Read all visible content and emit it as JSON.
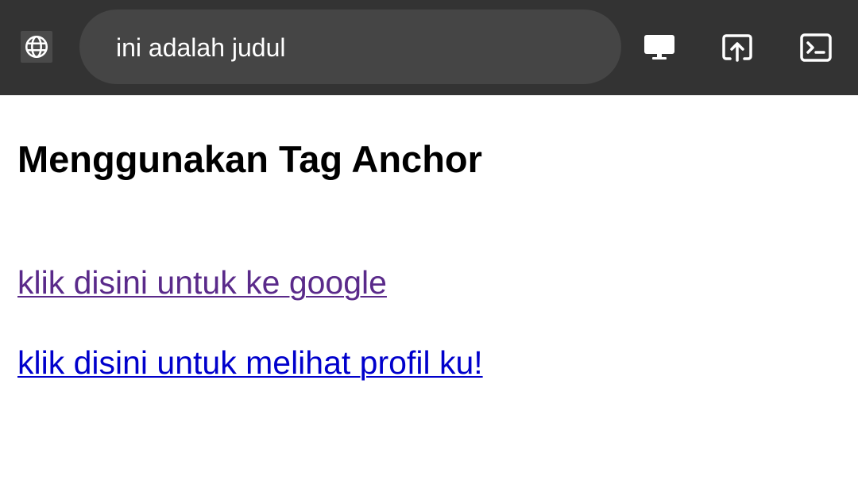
{
  "browser": {
    "address_text": "ini adalah judul",
    "site_icon": "globe-icon",
    "actions": [
      {
        "icon": "desktop-icon"
      },
      {
        "icon": "share-icon"
      },
      {
        "icon": "terminal-icon"
      }
    ],
    "toolbar_color": "#333333",
    "address_bar_color": "#454545"
  },
  "page": {
    "title": "Menggunakan Tag Anchor",
    "links": [
      {
        "text": "klik disini untuk ke google",
        "color": "#5a2a8a"
      },
      {
        "text": "klik disini untuk melihat profil ku!",
        "color": "#0000cc"
      }
    ]
  }
}
